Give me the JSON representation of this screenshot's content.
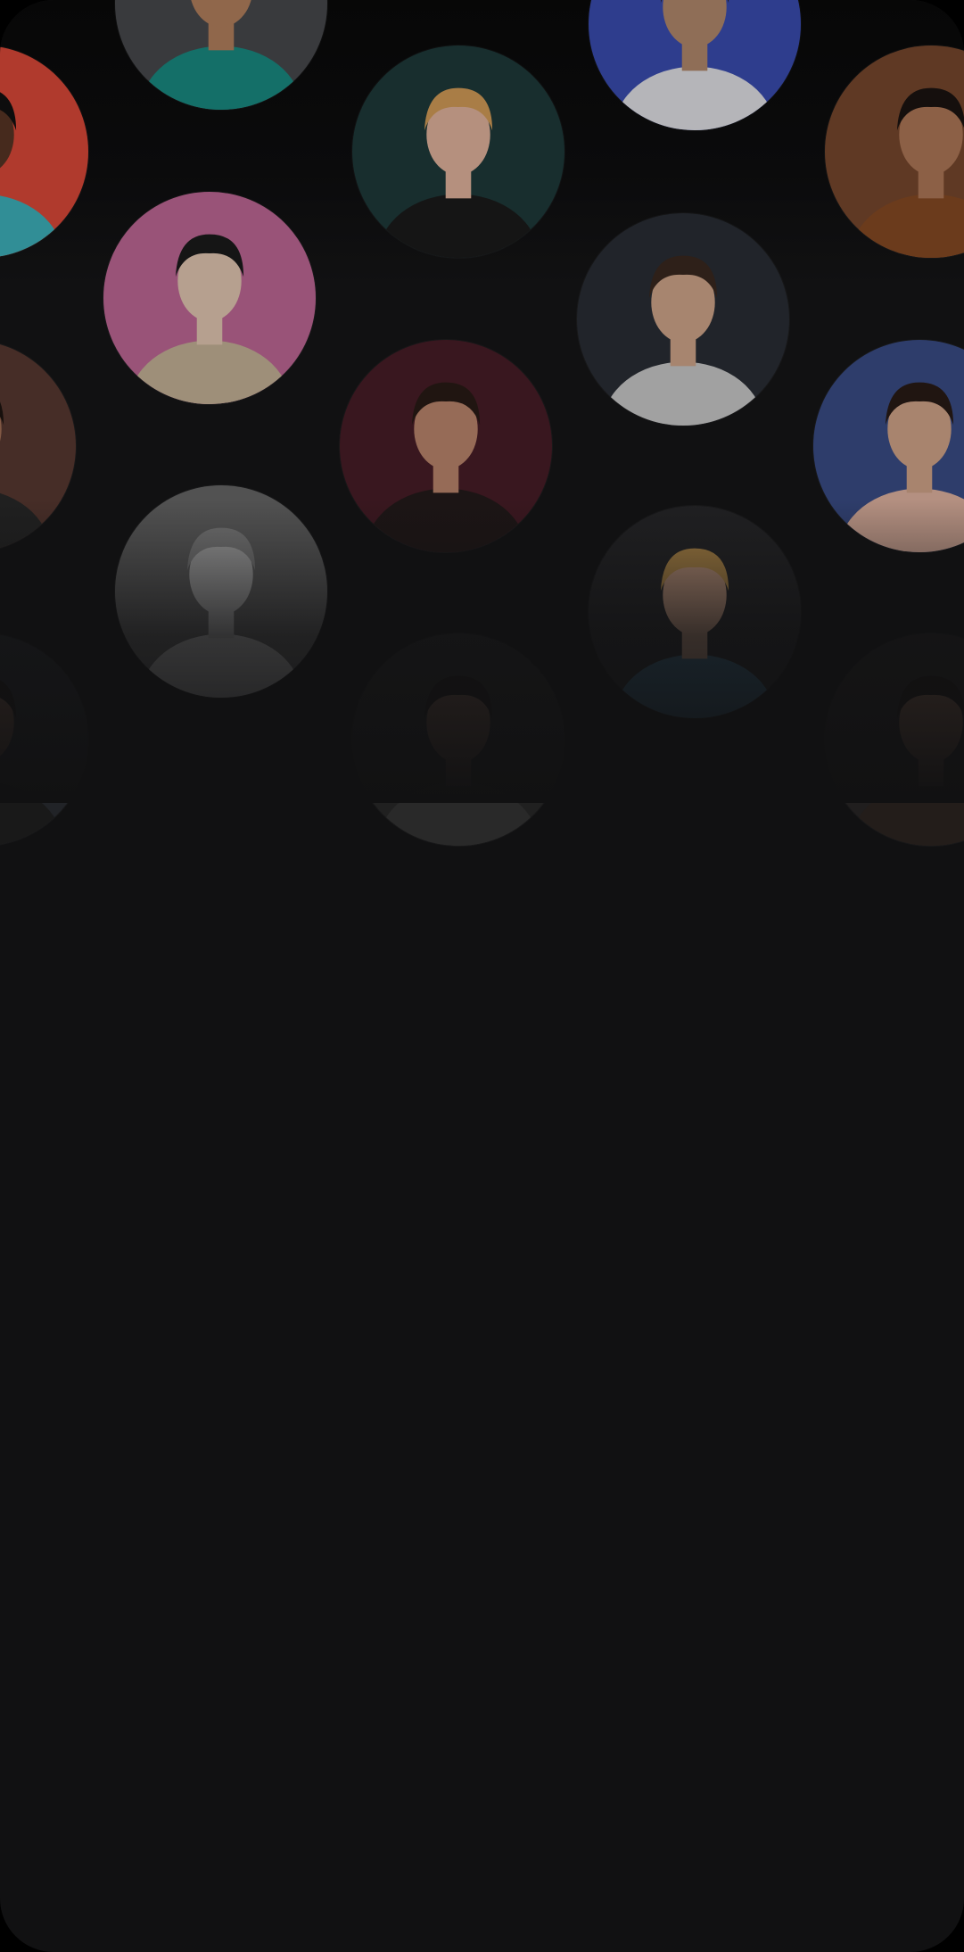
{
  "screen": {
    "background": "#111112"
  },
  "artists": [
    {
      "name": "artist-green-dress",
      "bg": "#4a4b4f",
      "accent": "#1a8f86",
      "skin": "#b98461",
      "hair": "#2a1c16"
    },
    {
      "name": "artist-white-suit",
      "bg": "#3c4fb5",
      "accent": "#e8e8ee",
      "skin": "#b88d70",
      "hair": "#2a201b"
    },
    {
      "name": "artist-teal-shirt",
      "bg": "#e24b3a",
      "accent": "#3fb7c0",
      "skin": "#5a3626",
      "hair": "#111111"
    },
    {
      "name": "artist-blonde-mic",
      "bg": "#1f3b3c",
      "accent": "#1c1c1c",
      "skin": "#e8b9a2",
      "hair": "#d9a05a"
    },
    {
      "name": "artist-brown-shirt",
      "bg": "#7a4a2f",
      "accent": "#8a4c25",
      "skin": "#b47c5a",
      "hair": "#1b1411"
    },
    {
      "name": "artist-green-hair",
      "bg": "#c46b9a",
      "accent": "#cbb89c",
      "skin": "#e9cdb8",
      "hair": "#1c1c1c"
    },
    {
      "name": "artist-grey-jacket",
      "bg": "#2b2f36",
      "accent": "#cfcfcf",
      "skin": "#d6ab8f",
      "hair": "#3b2a20"
    },
    {
      "name": "artist-dark-stage",
      "bg": "#5a3a32",
      "accent": "#2a2a2a",
      "skin": "#a67158",
      "hair": "#1e1511"
    },
    {
      "name": "artist-black-jacket",
      "bg": "#4a1e28",
      "accent": "#241c1c",
      "skin": "#c08a70",
      "hair": "#2a1b16"
    },
    {
      "name": "artist-pink-suit",
      "bg": "#3b4f8a",
      "accent": "#e7b9a6",
      "skin": "#d8a98e",
      "hair": "#2a1c16"
    },
    {
      "name": "artist-monochrome",
      "bg": "#6a6a6a",
      "accent": "#cfcfcf",
      "skin": "#bdbdbd",
      "hair": "#8d8d8d"
    },
    {
      "name": "artist-blonde-colorful",
      "bg": "#2a2a2c",
      "accent": "#3d6f8f",
      "skin": "#d7a88e",
      "hair": "#c99c52"
    },
    {
      "name": "artist-dim-left",
      "bg": "#2b2d33",
      "accent": "#202020",
      "skin": "#9a6e58",
      "hair": "#1a1512"
    },
    {
      "name": "artist-dim-center",
      "bg": "#2a2a2a",
      "accent": "#353535",
      "skin": "#8f6a58",
      "hair": "#1c1714"
    },
    {
      "name": "artist-dim-right",
      "bg": "#2a2727",
      "accent": "#2d2622",
      "skin": "#a97a62",
      "hair": "#1d1613"
    }
  ]
}
